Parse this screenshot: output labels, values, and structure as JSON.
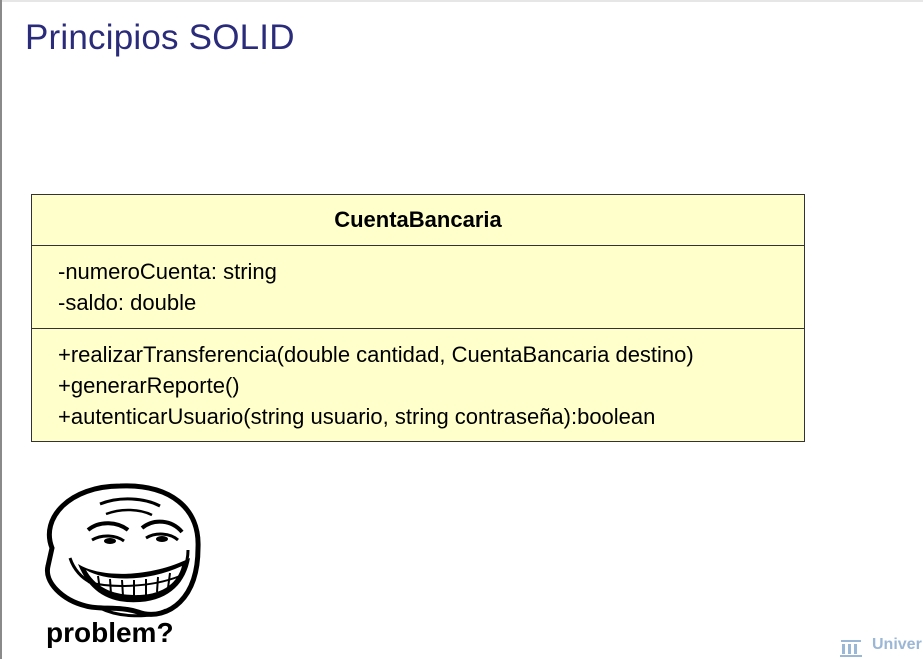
{
  "slide": {
    "title": "Principios SOLID"
  },
  "uml": {
    "class_name": "CuentaBancaria",
    "attributes": [
      "-numeroCuenta: string",
      "-saldo: double"
    ],
    "methods": [
      "+realizarTransferencia(double cantidad, CuentaBancaria destino)",
      "+generarReporte()",
      "+autenticarUsuario(string usuario, string contraseña):boolean"
    ],
    "fill_color": "#ffffcc"
  },
  "meme": {
    "caption": "problem?"
  },
  "footer": {
    "logo_text": "Univer"
  },
  "colors": {
    "title": "#2b2b7b",
    "logo": "#9ab7d6"
  }
}
